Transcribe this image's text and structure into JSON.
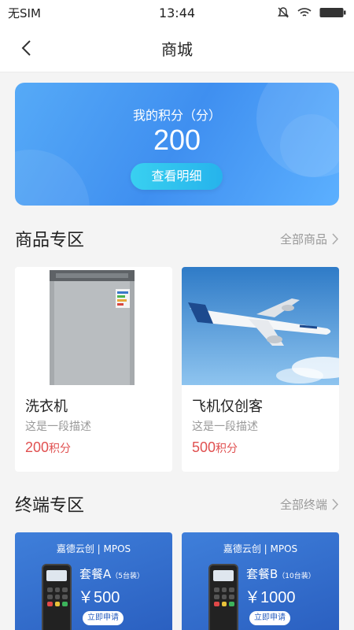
{
  "status_bar": {
    "carrier": "无SIM",
    "time": "13:44"
  },
  "nav": {
    "title": "商城"
  },
  "points": {
    "label": "我的积分（分）",
    "value": "200",
    "detail_button": "查看明细"
  },
  "products_section": {
    "title": "商品专区",
    "more": "全部商品",
    "items": [
      {
        "name": "洗衣机",
        "desc": "这是一段描述",
        "price": "200",
        "unit": "积分",
        "image": "washing-machine"
      },
      {
        "name": "飞机仅创客",
        "desc": "这是一段描述",
        "price": "500",
        "unit": "积分",
        "image": "airplane"
      }
    ]
  },
  "terminals_section": {
    "title": "终端专区",
    "more": "全部终端",
    "items": [
      {
        "brand": "嘉德云创 | MPOS",
        "plan": "套餐A",
        "qty": "（5台装）",
        "price": "￥500",
        "apply": "立即申请"
      },
      {
        "brand": "嘉德云创 | MPOS",
        "plan": "套餐B",
        "qty": "（10台装）",
        "price": "￥1000",
        "apply": "立即申请"
      }
    ]
  },
  "colors": {
    "accent_blue": "#3f8ff0",
    "price_red": "#e05050"
  }
}
